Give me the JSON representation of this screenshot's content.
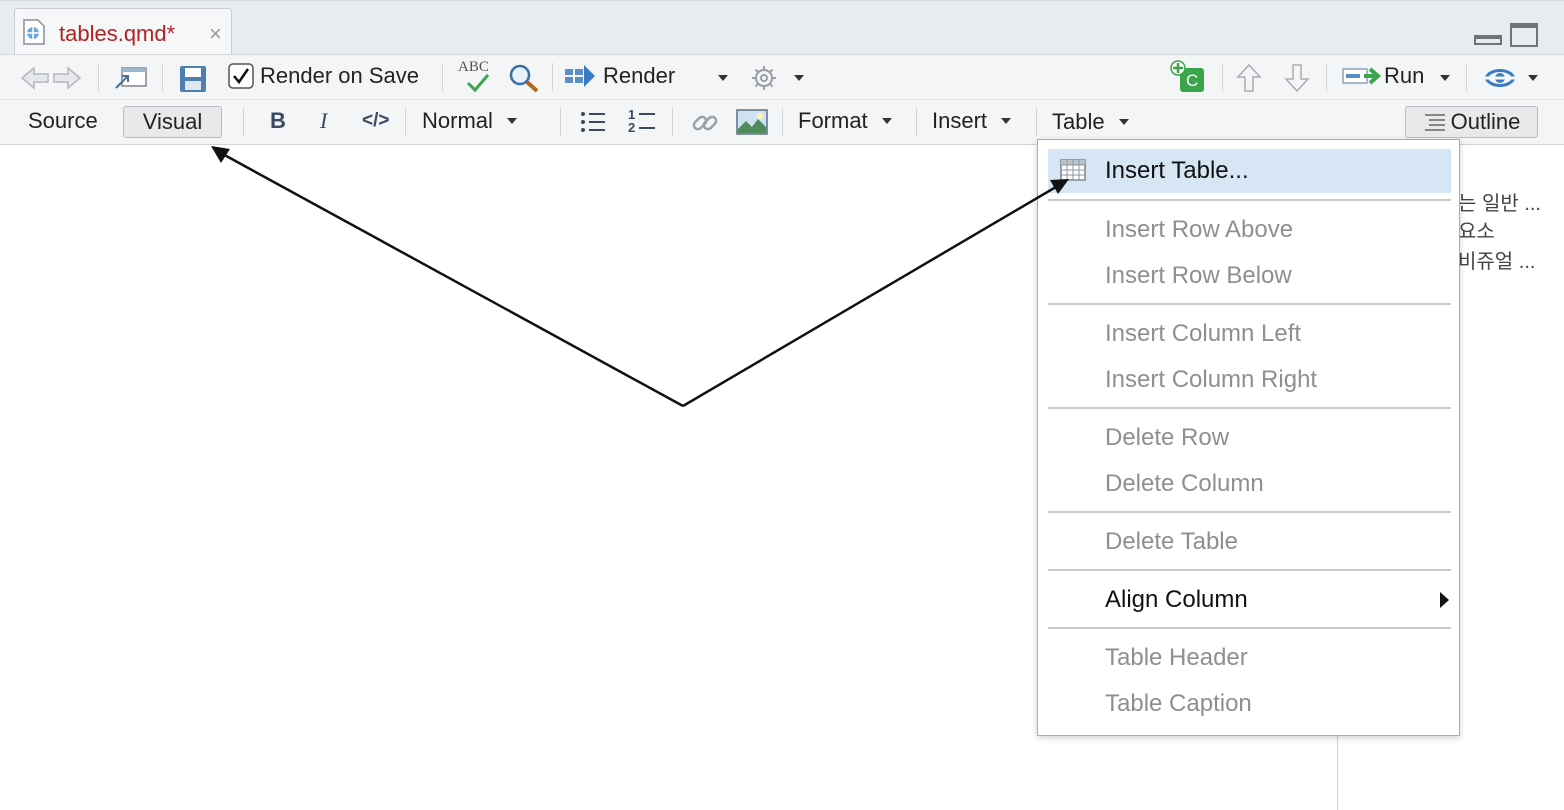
{
  "tab": {
    "title": "tables.qmd*",
    "close": "×"
  },
  "toolbar": {
    "render_on_save": "Render on Save",
    "render_on_save_checked": true,
    "spell_label": "ABC",
    "render": "Render",
    "run": "Run",
    "chunk_label": "C"
  },
  "editor_toolbar": {
    "source": "Source",
    "visual": "Visual",
    "bold": "B",
    "italic": "I",
    "code": "</>",
    "block_style": "Normal",
    "numbered_1": "1",
    "numbered_2": "2",
    "format": "Format",
    "insert": "Insert",
    "table": "Table",
    "outline": "Outline"
  },
  "outline": {
    "lines": [
      "는 일반 ...",
      "요소",
      "비쥬얼 ..."
    ]
  },
  "table_menu": {
    "items": [
      {
        "label": "Insert Table...",
        "enabled": true,
        "highlighted": true
      },
      {
        "label": "Insert Row Above",
        "enabled": false
      },
      {
        "label": "Insert Row Below",
        "enabled": false
      },
      {
        "label": "Insert Column Left",
        "enabled": false
      },
      {
        "label": "Insert Column Right",
        "enabled": false
      },
      {
        "label": "Delete Row",
        "enabled": false
      },
      {
        "label": "Delete Column",
        "enabled": false
      },
      {
        "label": "Delete Table",
        "enabled": false
      },
      {
        "label": "Align Column",
        "enabled": true,
        "submenu": true
      },
      {
        "label": "Table Header",
        "enabled": false
      },
      {
        "label": "Table Caption",
        "enabled": false
      }
    ]
  },
  "colors": {
    "tab_title": "#b22222",
    "menu_highlight": "#d6e6f5",
    "disabled_text": "#8f8f8f",
    "accent_blue": "#3a7cc4",
    "accent_green": "#3aa54a"
  }
}
